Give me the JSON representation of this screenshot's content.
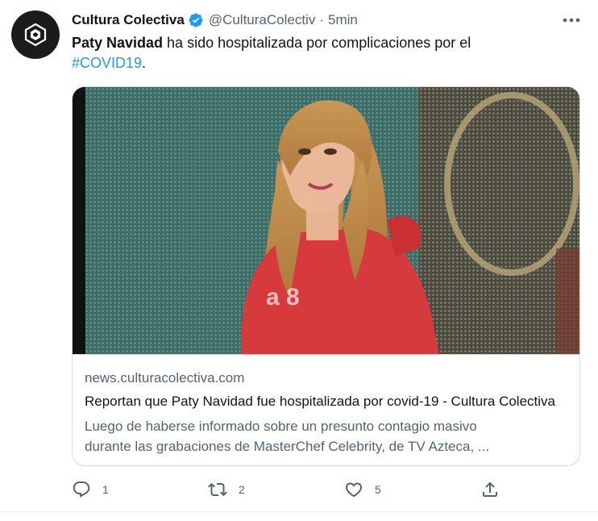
{
  "tweet": {
    "author_name": "Cultura Colectiva",
    "author_handle": "@CulturaColectiv",
    "separator": "·",
    "time": "5min",
    "text_bold": "Paty Navidad",
    "text_rest": " ha sido hospitalizada por complicaciones por el",
    "hashtag": "#COVID19",
    "text_end": "."
  },
  "card": {
    "domain": "news.culturacolectiva.com",
    "title": "Reportan que Paty Navidad fue hospitalizada por covid-19 - Cultura Colectiva",
    "description_line1": "Luego de haberse informado sobre un presunto contagio masivo",
    "description_line2": "durante las grabaciones de MasterChef Celebrity, de TV Azteca, ..."
  },
  "actions": {
    "reply_count": "1",
    "retweet_count": "2",
    "like_count": "5"
  },
  "colors": {
    "accent": "#1d9bf0",
    "secondary_text": "#536471",
    "border": "#cfd9de"
  },
  "icons": [
    "brand-logo-icon",
    "verified-badge-icon",
    "more-options-icon",
    "reply-icon",
    "retweet-icon",
    "like-icon",
    "share-icon"
  ]
}
